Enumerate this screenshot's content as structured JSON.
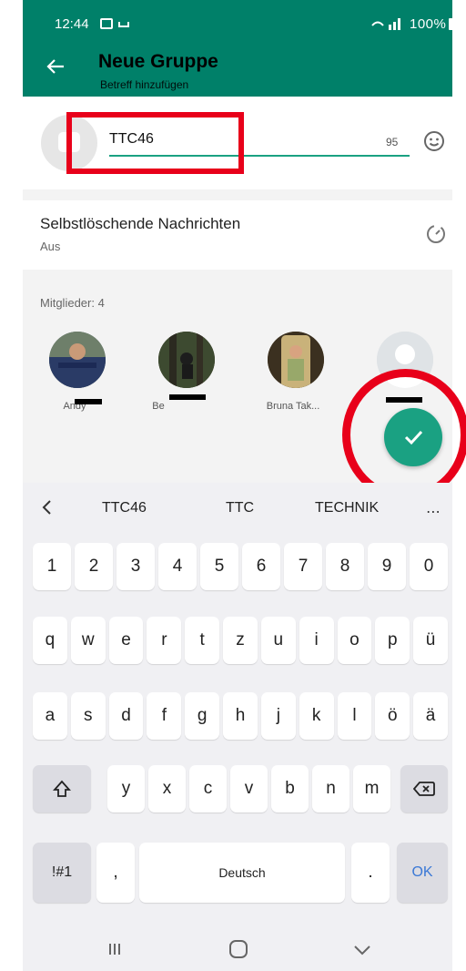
{
  "status": {
    "time": "12:44",
    "icons": "100%"
  },
  "header": {
    "title": "Neue Gruppe",
    "subtitle": "Betreff hinzufügen"
  },
  "name_field": {
    "value": "TTC46",
    "counter": "95"
  },
  "disappearing": {
    "title": "Selbstlöschende Nachrichten",
    "value": "Aus"
  },
  "members": {
    "heading": "Mitglieder: 4",
    "items": [
      {
        "name": "Andy"
      },
      {
        "name": "Be"
      },
      {
        "name": "Bruna Tak..."
      },
      {
        "name": ""
      }
    ]
  },
  "keyboard": {
    "suggestions": [
      "TTC46",
      "TTC",
      "TECHNIK"
    ],
    "row_numbers": [
      "1",
      "2",
      "3",
      "4",
      "5",
      "6",
      "7",
      "8",
      "9",
      "0"
    ],
    "row1": [
      "q",
      "w",
      "e",
      "r",
      "t",
      "z",
      "u",
      "i",
      "o",
      "p",
      "ü"
    ],
    "row2": [
      "a",
      "s",
      "d",
      "f",
      "g",
      "h",
      "j",
      "k",
      "l",
      "ö",
      "ä"
    ],
    "row3": [
      "y",
      "x",
      "c",
      "v",
      "b",
      "n",
      "m"
    ],
    "symbols_key": "!#1",
    "comma_key": ",",
    "space_label": "Deutsch",
    "period_key": ".",
    "ok_key": "OK"
  },
  "colors": {
    "header": "#008069",
    "accent": "#1aa182",
    "highlight": "#e8001a"
  }
}
